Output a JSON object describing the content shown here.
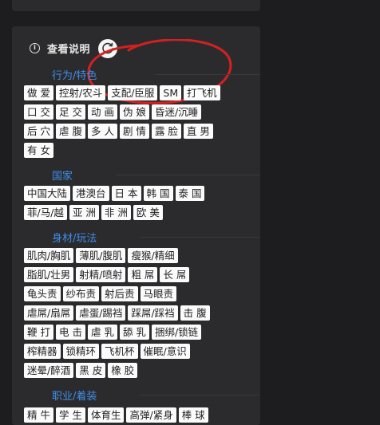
{
  "info": {
    "label": "查看说明"
  },
  "sections": [
    {
      "title": "行为/特色",
      "rows": [
        [
          "做 爱",
          "控射/农斗",
          "支配/臣服",
          "SM",
          "打飞机"
        ],
        [
          "口 交",
          "足 交",
          "动 画",
          "伪 娘",
          "昏迷/沉睡"
        ],
        [
          "后 穴",
          "虐 腹",
          "多 人",
          "剧 情",
          "露 脸",
          "直 男"
        ],
        [
          "有 女"
        ]
      ]
    },
    {
      "title": "国家",
      "rows": [
        [
          "中国大陆",
          "港澳台",
          "日 本",
          "韩 国",
          "泰 国"
        ],
        [
          "菲/马/越",
          "亚 洲",
          "非 洲",
          "欧 美"
        ]
      ]
    },
    {
      "title": "身材/玩法",
      "rows": [
        [
          "肌肉/胸肌",
          "薄肌/腹肌",
          "瘦猴/精细"
        ],
        [
          "脂肌/壮男",
          "射精/喷射",
          "粗 屌",
          "长 屌"
        ],
        [
          "龟头责",
          "纱布责",
          "射后责",
          "马眼责"
        ],
        [
          "虐屌/扇屌",
          "虐蛋/踢裆",
          "踩屌/踩裆",
          "击 腹"
        ],
        [
          "鞭 打",
          "电 击",
          "虐 乳",
          "舔 乳",
          "捆绑/锁链"
        ],
        [
          "榨精器",
          "锁精环",
          "飞机杯",
          "催眠/意识"
        ],
        [
          "迷晕/醉酒",
          "黑 皮",
          "橡 胶"
        ]
      ]
    },
    {
      "title": "职业/着装",
      "rows": [
        [
          "精 牛",
          "学 生",
          "体育生",
          "高弹/紧身",
          "棒 球"
        ]
      ]
    }
  ]
}
